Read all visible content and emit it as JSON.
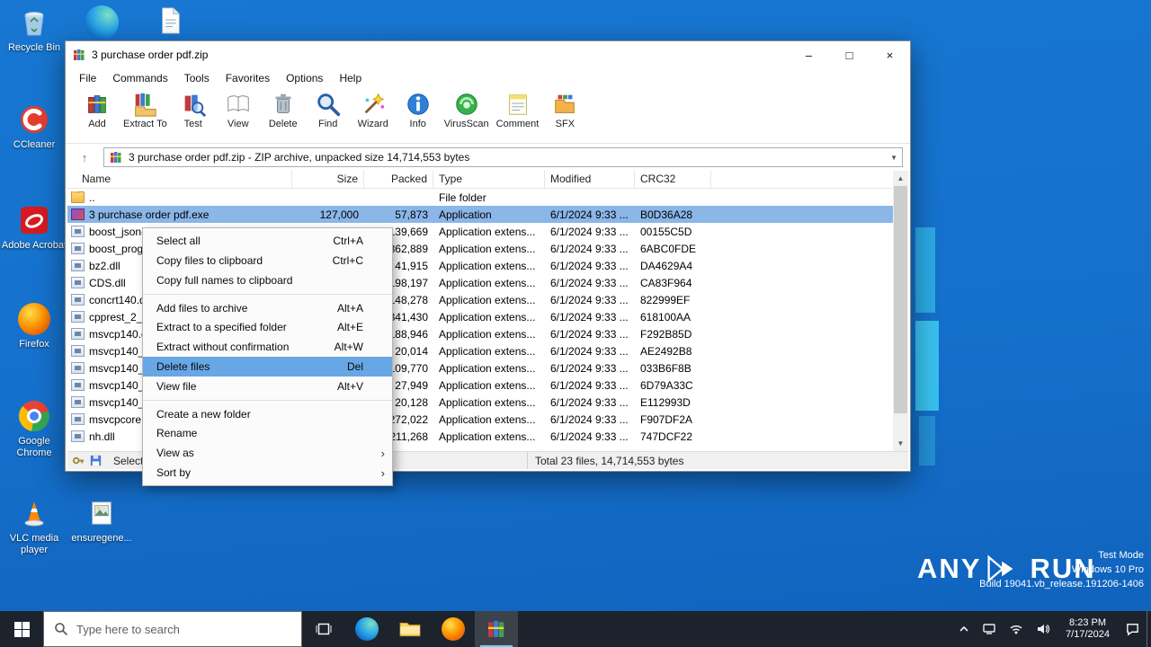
{
  "colors": {
    "desktop_blue": "#1777d2",
    "selection": "#8ab6e8",
    "menu_highlight": "#67a7e6",
    "taskbar": "#1c232d",
    "accent_blue": "#0078d7"
  },
  "desktop": {
    "icons": [
      {
        "label": "Recycle Bin"
      },
      {
        "label": "CCleaner"
      },
      {
        "label": "Adobe Acrobat"
      },
      {
        "label": "Firefox"
      },
      {
        "label": "Google Chrome"
      },
      {
        "label": "VLC media player"
      },
      {
        "label": "ensuregene..."
      }
    ]
  },
  "winrar": {
    "title": "3 purchase order pdf.zip",
    "controls": {
      "minimize": "–",
      "maximize": "□",
      "close": "×"
    },
    "menubar": [
      "File",
      "Commands",
      "Tools",
      "Favorites",
      "Options",
      "Help"
    ],
    "toolbar": [
      {
        "label": "Add"
      },
      {
        "label": "Extract To"
      },
      {
        "label": "Test"
      },
      {
        "label": "View"
      },
      {
        "label": "Delete"
      },
      {
        "label": "Find"
      },
      {
        "label": "Wizard"
      },
      {
        "label": "Info"
      },
      {
        "label": "VirusScan"
      },
      {
        "label": "Comment"
      },
      {
        "label": "SFX"
      }
    ],
    "address": {
      "up_glyph": "↑",
      "text": "3 purchase order pdf.zip - ZIP archive, unpacked size 14,714,553 bytes",
      "caret": "▼"
    },
    "columns": [
      "Name",
      "Size",
      "Packed",
      "Type",
      "Modified",
      "CRC32"
    ],
    "files": [
      {
        "class": "ic-folder",
        "name": "..",
        "size": "",
        "packed": "",
        "type": "File folder",
        "modified": "",
        "crc": ""
      },
      {
        "class": "ic-exe selected",
        "name": "3 purchase order pdf.exe",
        "size": "127,000",
        "packed": "57,873",
        "type": "Application",
        "modified": "6/1/2024 9:33 ...",
        "crc": "B0D36A28"
      },
      {
        "class": "ic-dll",
        "name": "boost_json-v...",
        "size": "",
        "packed": "139,669",
        "type": "Application extens...",
        "modified": "6/1/2024 9:33 ...",
        "crc": "00155C5D"
      },
      {
        "class": "ic-dll",
        "name": "boost_progra...",
        "size": "",
        "packed": "862,889",
        "type": "Application extens...",
        "modified": "6/1/2024 9:33 ...",
        "crc": "6ABC0FDE"
      },
      {
        "class": "ic-dll",
        "name": "bz2.dll",
        "size": "",
        "packed": "41,915",
        "type": "Application extens...",
        "modified": "6/1/2024 9:33 ...",
        "crc": "DA4629A4"
      },
      {
        "class": "ic-dll",
        "name": "CDS.dll",
        "size": "",
        "packed": "198,197",
        "type": "Application extens...",
        "modified": "6/1/2024 9:33 ...",
        "crc": "CA83F964"
      },
      {
        "class": "ic-dll",
        "name": "concrt140.dl...",
        "size": "",
        "packed": "148,278",
        "type": "Application extens...",
        "modified": "6/1/2024 9:33 ...",
        "crc": "822999EF"
      },
      {
        "class": "ic-dll",
        "name": "cpprest_2_10...",
        "size": "",
        "packed": "341,430",
        "type": "Application extens...",
        "modified": "6/1/2024 9:33 ...",
        "crc": "618100AA"
      },
      {
        "class": "ic-dll",
        "name": "msvcp140.dl...",
        "size": "",
        "packed": "188,946",
        "type": "Application extens...",
        "modified": "6/1/2024 9:33 ...",
        "crc": "F292B85D"
      },
      {
        "class": "ic-dll",
        "name": "msvcp140_1...",
        "size": "",
        "packed": "20,014",
        "type": "Application extens...",
        "modified": "6/1/2024 9:33 ...",
        "crc": "AE2492B8"
      },
      {
        "class": "ic-dll",
        "name": "msvcp140_2...",
        "size": "",
        "packed": "109,770",
        "type": "Application extens...",
        "modified": "6/1/2024 9:33 ...",
        "crc": "033B6F8B"
      },
      {
        "class": "ic-dll",
        "name": "msvcp140_at...",
        "size": "",
        "packed": "27,949",
        "type": "Application extens...",
        "modified": "6/1/2024 9:33 ...",
        "crc": "6D79A33C"
      },
      {
        "class": "ic-dll",
        "name": "msvcp140_c...",
        "size": "",
        "packed": "20,128",
        "type": "Application extens...",
        "modified": "6/1/2024 9:33 ...",
        "crc": "E112993D"
      },
      {
        "class": "ic-dll",
        "name": "msvcpcore.d...",
        "size": "",
        "packed": "272,022",
        "type": "Application extens...",
        "modified": "6/1/2024 9:33 ...",
        "crc": "F907DF2A"
      },
      {
        "class": "ic-dll",
        "name": "nh.dll",
        "size": "",
        "packed": "1,211,268",
        "type": "Application extens...",
        "modified": "6/1/2024 9:33 ...",
        "crc": "747DCF22"
      }
    ],
    "status": {
      "selected_label": "Selected",
      "total_label": "Total 23 files, 14,714,553 bytes"
    }
  },
  "context_menu": {
    "items": [
      {
        "label": "Select all",
        "shortcut": "Ctrl+A"
      },
      {
        "label": "Copy files to clipboard",
        "shortcut": "Ctrl+C"
      },
      {
        "label": "Copy full names to clipboard"
      },
      {
        "class": "sep-before",
        "label": "Add files to archive",
        "shortcut": "Alt+A"
      },
      {
        "label": "Extract to a specified folder",
        "shortcut": "Alt+E"
      },
      {
        "label": "Extract without confirmation",
        "shortcut": "Alt+W"
      },
      {
        "class": "highlight",
        "label": "Delete files",
        "shortcut": "Del"
      },
      {
        "label": "View file",
        "shortcut": "Alt+V"
      },
      {
        "class": "sep-before",
        "label": "Create a new folder"
      },
      {
        "label": "Rename"
      },
      {
        "label": "View as",
        "arrow": "›"
      },
      {
        "label": "Sort by",
        "arrow": "›"
      }
    ]
  },
  "taskbar": {
    "search_text": "Type here to search",
    "clock_time": "8:23 PM",
    "clock_date": "7/17/2024"
  },
  "watermark": {
    "brand_left": "ANY",
    "brand_right": "RUN",
    "mode": "Test Mode",
    "os": "Windows 10 Pro",
    "build": "Build 19041.vb_release.191206-1406"
  }
}
